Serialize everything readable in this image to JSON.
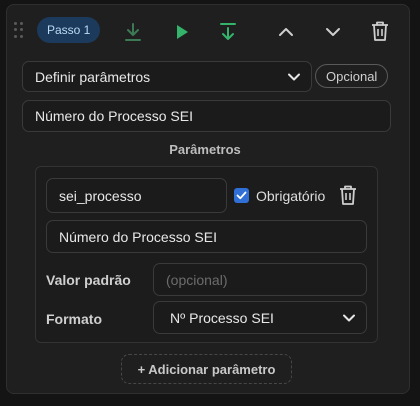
{
  "step": {
    "badge_label": "Passo 1"
  },
  "toolbar": {
    "icons": [
      "download-icon",
      "play-icon",
      "step-into-icon",
      "move-up-icon",
      "move-down-icon",
      "trash-icon"
    ],
    "colors": {
      "play": "#34b36b",
      "step_into": "#34b36b",
      "download": "#3c7a55"
    }
  },
  "action": {
    "selected": "Definir parâmetros",
    "optional_label": "Opcional"
  },
  "description": {
    "value": "Número do Processo SEI"
  },
  "parameters": {
    "title": "Parâmetros",
    "items": [
      {
        "name": "sei_processo",
        "required_label": "Obrigatório",
        "required": true,
        "description": "Número do Processo SEI",
        "default_label": "Valor padrão",
        "default_placeholder": "(opcional)",
        "format_label": "Formato",
        "format_selected": "Nº Processo SEI"
      }
    ],
    "add_label": "+ Adicionar parâmetro"
  }
}
